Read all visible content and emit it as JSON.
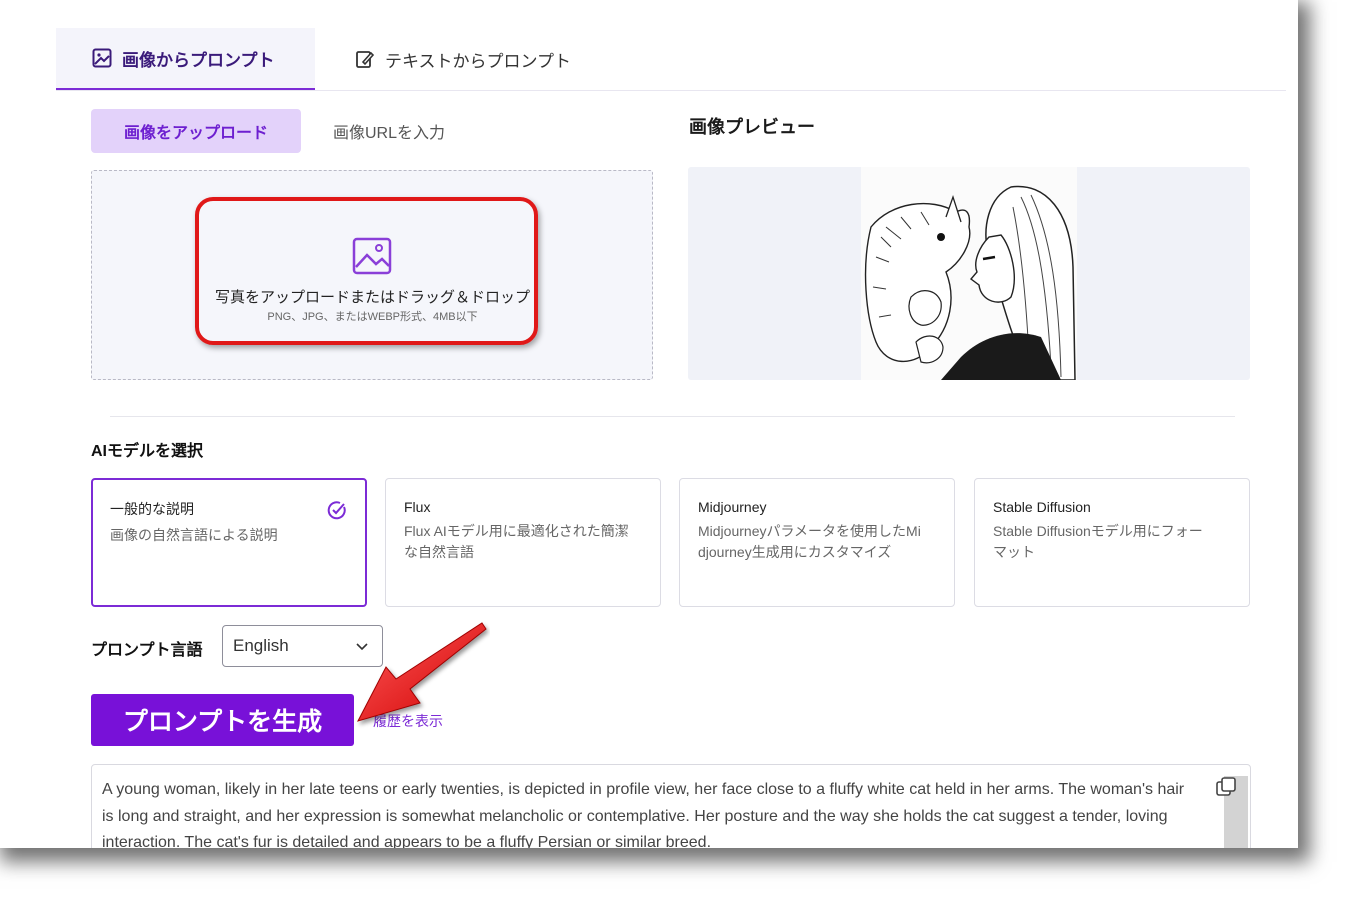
{
  "tabs": [
    {
      "label": "画像からプロンプト",
      "icon": "image-prompt-icon",
      "active": true
    },
    {
      "label": "テキストからプロンプト",
      "icon": "text-edit-icon",
      "active": false
    }
  ],
  "upload": {
    "subtabs": [
      "画像をアップロード",
      "画像URLを入力"
    ],
    "drop_text": "写真をアップロードまたはドラッグ＆ドロップ",
    "drop_subtext": "PNG、JPG、またはWEBP形式、4MB以下",
    "icon": "image-upload-icon"
  },
  "preview": {
    "title": "画像プレビュー"
  },
  "model": {
    "heading": "AIモデルを選択",
    "cards": [
      {
        "title": "一般的な説明",
        "desc": "画像の自然言語による説明",
        "selected": true
      },
      {
        "title": "Flux",
        "desc": "Flux AIモデル用に最適化された簡潔な自然言語",
        "selected": false
      },
      {
        "title": "Midjourney",
        "desc": "Midjourneyパラメータを使用したMidjourney生成用にカスタマイズ",
        "selected": false
      },
      {
        "title": "Stable Diffusion",
        "desc": "Stable Diffusionモデル用にフォーマット",
        "selected": false
      }
    ]
  },
  "language": {
    "label": "プロンプト言語",
    "selected": "English"
  },
  "actions": {
    "generate_label": "プロンプトを生成",
    "history_label": "履歴を表示"
  },
  "output": {
    "text": "A young woman, likely in her late teens or early twenties, is depicted in profile view, her face close to a fluffy white cat held in her arms.  The woman's hair is long and straight, and her expression is somewhat melancholic or contemplative.  Her posture and the way she holds the cat suggest a tender, loving interaction. The cat's fur is detailed and appears to be a fluffy Persian or similar breed."
  },
  "colors": {
    "accent": "#7811d8",
    "accent_light": "#e3d2fa",
    "highlight_red": "#e01818"
  }
}
